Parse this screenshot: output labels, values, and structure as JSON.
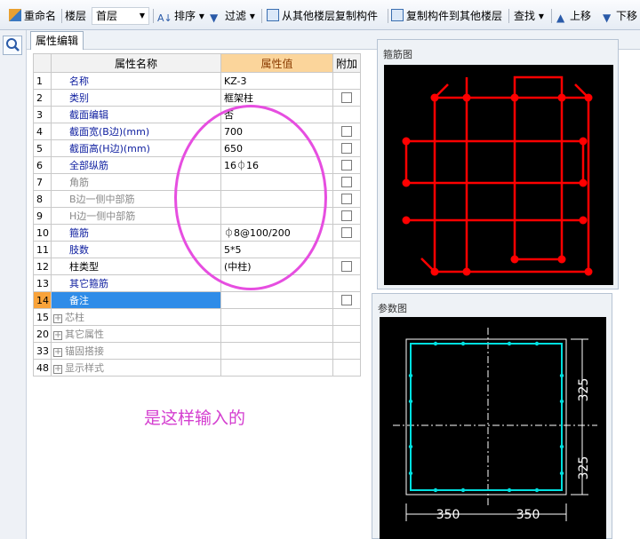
{
  "toolbar": {
    "rename_label": "重命名",
    "floor_label": "楼层",
    "floor_value": "首层",
    "sort_label": "排序",
    "filter_label": "过滤",
    "copy_from_label": "从其他楼层复制构件",
    "copy_to_label": "复制构件到其他楼层",
    "find_label": "查找",
    "move_up_label": "上移",
    "move_down_label": "下移"
  },
  "tab": {
    "label": "属性编辑"
  },
  "table": {
    "headers": {
      "name": "属性名称",
      "value": "属性值",
      "extra": "附加"
    },
    "rows": [
      {
        "num": "1",
        "name": "名称",
        "value": "KZ-3",
        "style": "blue",
        "checkbox": false
      },
      {
        "num": "2",
        "name": "类别",
        "value": "框架柱",
        "style": "blue",
        "checkbox": true
      },
      {
        "num": "3",
        "name": "截面编辑",
        "value": "否",
        "style": "blue",
        "checkbox": false
      },
      {
        "num": "4",
        "name": "截面宽(B边)(mm)",
        "value": "700",
        "style": "blue",
        "checkbox": true
      },
      {
        "num": "5",
        "name": "截面高(H边)(mm)",
        "value": "650",
        "style": "blue",
        "checkbox": true
      },
      {
        "num": "6",
        "name": "全部纵筋",
        "value": "16⏀16",
        "style": "blue",
        "checkbox": true
      },
      {
        "num": "7",
        "name": "角筋",
        "value": "",
        "style": "gray",
        "checkbox": true
      },
      {
        "num": "8",
        "name": "B边一侧中部筋",
        "value": "",
        "style": "gray",
        "checkbox": true
      },
      {
        "num": "9",
        "name": "H边一侧中部筋",
        "value": "",
        "style": "gray",
        "checkbox": true
      },
      {
        "num": "10",
        "name": "箍筋",
        "value": "⏀8@100/200",
        "style": "blue",
        "checkbox": true
      },
      {
        "num": "11",
        "name": "肢数",
        "value": "5*5",
        "style": "blue",
        "checkbox": false
      },
      {
        "num": "12",
        "name": "柱类型",
        "value": "(中柱)",
        "style": "dark",
        "checkbox": true
      },
      {
        "num": "13",
        "name": "其它箍筋",
        "value": "",
        "style": "blue",
        "checkbox": false
      },
      {
        "num": "14",
        "name": "备注",
        "value": "",
        "style": "selected",
        "checkbox": true
      },
      {
        "num": "15",
        "name": "芯柱",
        "value": "",
        "style": "group",
        "checkbox": false
      },
      {
        "num": "20",
        "name": "其它属性",
        "value": "",
        "style": "group",
        "checkbox": false
      },
      {
        "num": "33",
        "name": "锚固搭接",
        "value": "",
        "style": "group",
        "checkbox": false
      },
      {
        "num": "48",
        "name": "显示样式",
        "value": "",
        "style": "group",
        "checkbox": false
      }
    ]
  },
  "annotation": {
    "text": "是这样输入的"
  },
  "stirrup_panel": {
    "title": "箍筋图"
  },
  "param_panel": {
    "title": "参数图",
    "dim_h": "325",
    "dim_w": "350"
  },
  "colors": {
    "rebar": "#ff0000",
    "outline": "#00e0e0",
    "annotation": "#e64ee0"
  }
}
